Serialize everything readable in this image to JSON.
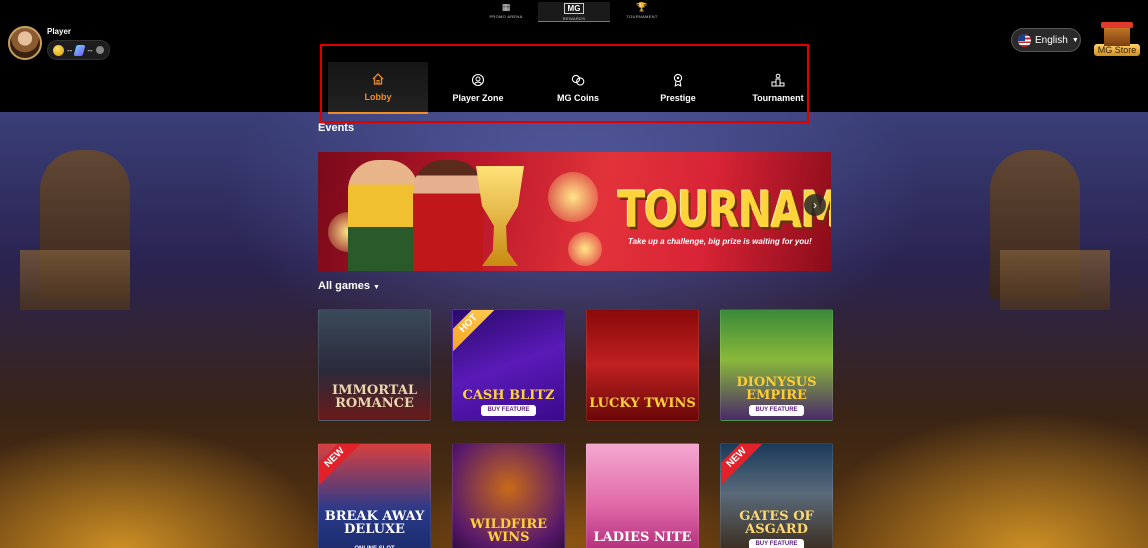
{
  "user": {
    "name": "Player",
    "coin_balance": "--",
    "gem_balance": "--"
  },
  "quick_nav": [
    {
      "id": "promo-arena",
      "glyph": "▦",
      "label": "PROMO ARENA"
    },
    {
      "id": "rewards",
      "glyph": "MG",
      "label": "REWARDS"
    },
    {
      "id": "tournament",
      "glyph": "🏆",
      "label": "TOURNAMENT"
    }
  ],
  "nav": {
    "tabs": [
      {
        "id": "lobby",
        "label": "Lobby",
        "icon": "home-icon",
        "active": true
      },
      {
        "id": "player-zone",
        "label": "Player Zone",
        "icon": "player-zone-icon",
        "active": false
      },
      {
        "id": "mg-coins",
        "label": "MG Coins",
        "icon": "coins-icon",
        "active": false
      },
      {
        "id": "prestige",
        "label": "Prestige",
        "icon": "prestige-icon",
        "active": false
      },
      {
        "id": "tournament",
        "label": "Tournament",
        "icon": "podium-icon",
        "active": false
      }
    ],
    "active_color": "#f28c28",
    "highlight_box_color": "#e00000"
  },
  "language": {
    "selected": "English",
    "flag": "us-flag-icon"
  },
  "store": {
    "label": "MG Store"
  },
  "events": {
    "title": "Events",
    "banner": {
      "headline": "TOURNAMENT",
      "subtitle": "Take up a challenge, big prize is waiting for you!"
    }
  },
  "games": {
    "title": "All games",
    "items": [
      {
        "id": "immortal-romance",
        "title": "Immortal Romance",
        "sub": "",
        "badge": "",
        "bg": "linear-gradient(180deg,#3a4a5a,#2a2a3a 55%,#6a1a1a)",
        "title_color": "#e8d8b0"
      },
      {
        "id": "cash-blitz",
        "title": "Cash Blitz",
        "sub": "BUY FEATURE",
        "badge": "HOT",
        "bg": "linear-gradient(160deg,#2a0a6a,#5a1ab8 50%,#3a0a8a)",
        "title_color": "#ffd23a"
      },
      {
        "id": "lucky-twins",
        "title": "Lucky Twins",
        "sub": "",
        "badge": "",
        "bg": "linear-gradient(180deg,#8a0a0a,#c02020 50%,#6a0808)",
        "title_color": "#ffd23a"
      },
      {
        "id": "dionysus-empire",
        "title": "Dionysus Empire",
        "sub": "BUY FEATURE",
        "badge": "",
        "bg": "linear-gradient(180deg,#3a8a3a,#8ab83a 45%,#4a2a6a)",
        "title_color": "#ffcc33"
      },
      {
        "id": "break-away-deluxe",
        "title": "Break Away Deluxe",
        "sub": "ONLINE SLOT",
        "badge": "NEW",
        "bg": "linear-gradient(180deg,#d84040,#2a3a8a 60%,#1a2a6a)",
        "title_color": "#ffffff"
      },
      {
        "id": "wildfire-wins",
        "title": "Wildfire Wins",
        "sub": "",
        "badge": "",
        "bg": "radial-gradient(circle at 50% 40%,#c86a18,#5a1a6a 70%,#2a0a3a)",
        "title_color": "#ffd23a"
      },
      {
        "id": "ladies-nite",
        "title": "Ladies Nite",
        "sub": "",
        "badge": "",
        "bg": "linear-gradient(180deg,#f4a8d0,#e06aa8 55%,#b02a7a)",
        "title_color": "#ffffff"
      },
      {
        "id": "gates-of-asgard",
        "title": "Gates of Asgard",
        "sub": "BUY FEATURE",
        "badge": "NEW",
        "bg": "linear-gradient(180deg,#1a3a5a,#5a6a7a 45%,#3a2a1a)",
        "title_color": "#ffd870"
      }
    ]
  }
}
